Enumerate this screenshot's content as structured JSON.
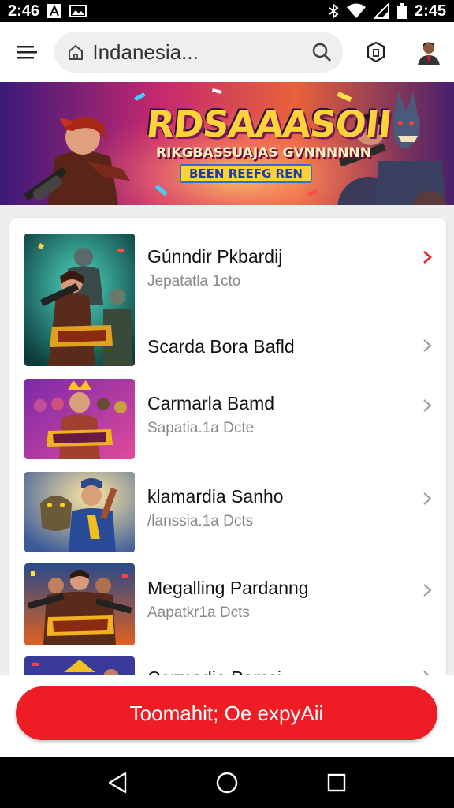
{
  "status_bar": {
    "time_left": "2:46",
    "time_right": "2:45"
  },
  "app_bar": {
    "search_value": "Indanesia..."
  },
  "banner": {
    "title": "RDSAAASOII",
    "subtitle": "RIKGBASSUAJAS GVNNNNNN",
    "tag": "BEEN REEFG REN"
  },
  "list": {
    "items": [
      {
        "title": "Gúnndir Pkbardij",
        "subtitle": "Jepatatla 1cto",
        "chevron_color": "#e5262a"
      },
      {
        "title": "Scarda Bora Bafld",
        "subtitle": "",
        "chevron_color": "#999999"
      },
      {
        "title": "Carmarla Bamd",
        "subtitle": "Sapatia.1a Dcte",
        "chevron_color": "#999999"
      },
      {
        "title": "klamardia Sanho",
        "subtitle": "/lanssia.1a Dcts",
        "chevron_color": "#999999"
      },
      {
        "title": "Megalling Pardanng",
        "subtitle": "Aapatkr1a Dcts",
        "chevron_color": "#999999"
      },
      {
        "title": "Carmadia Pamsi",
        "subtitle": "",
        "chevron_color": "#999999"
      }
    ]
  },
  "cta": {
    "label": "Toomahit; Oe expyAii",
    "color": "#ee1c24"
  }
}
